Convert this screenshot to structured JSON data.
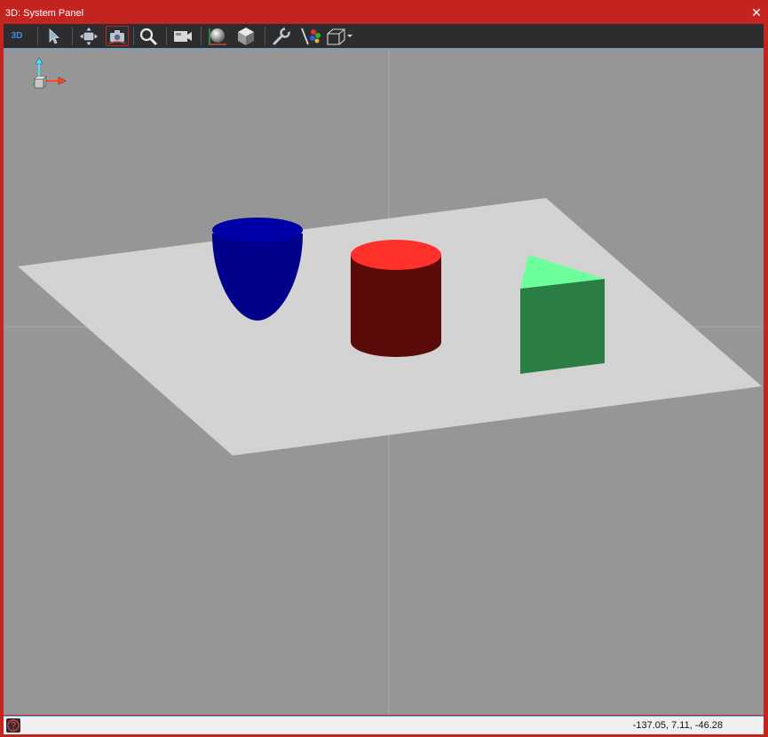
{
  "window": {
    "title": "3D: System Panel",
    "close_glyph": "✕"
  },
  "toolbar": {
    "mode_label": "3D",
    "buttons": [
      {
        "name": "3d-mode-button",
        "icon": "3d-label"
      },
      {
        "name": "select-tool-button",
        "icon": "cursor-arrow-icon"
      },
      {
        "name": "pan-tool-button",
        "icon": "move-arrows-icon"
      },
      {
        "name": "camera-orbit-button",
        "icon": "camera-icon"
      },
      {
        "name": "zoom-button",
        "icon": "magnifier-icon"
      },
      {
        "name": "camera-view-button",
        "icon": "video-camera-icon"
      },
      {
        "name": "sphere-render-button",
        "icon": "sphere-icon"
      },
      {
        "name": "cube-render-button",
        "icon": "cube-icon"
      },
      {
        "name": "settings-tool-button",
        "icon": "wrench-icon"
      },
      {
        "name": "color-palette-button",
        "icon": "palette-brush-icon"
      },
      {
        "name": "bounding-box-dropdown",
        "icon": "wireframe-box-icon"
      }
    ]
  },
  "status": {
    "coordinates": "-137.05, 7.11, -46.28"
  },
  "colors": {
    "frame": "#c42420",
    "toolbar_bg": "#2d2d30",
    "viewport_bg": "#969696",
    "plane": "#d3d3d3",
    "paraboloid": "#00008b",
    "cylinder_top": "#ff322b",
    "cylinder_side": "#5c0b0b",
    "prism_top": "#6dff9c",
    "prism_side": "#2a7e44",
    "accent_blue": "#5aa0d8"
  }
}
